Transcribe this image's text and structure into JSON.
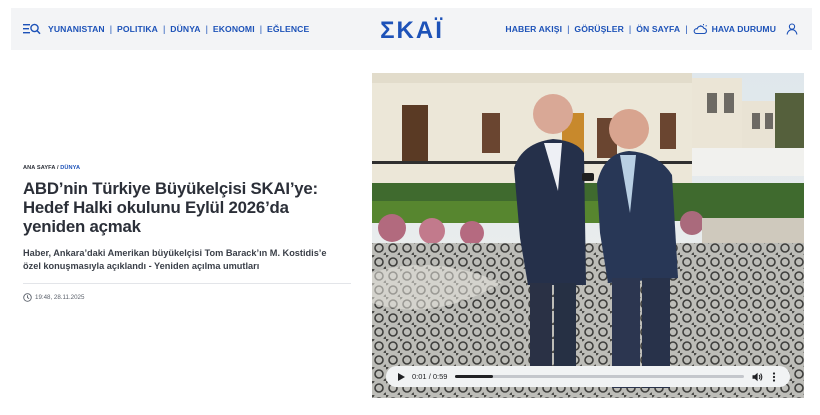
{
  "header": {
    "nav_left": [
      "YUNANISTAN",
      "POLITIKA",
      "DÜNYA",
      "EKONOMI",
      "EĞLENCE"
    ],
    "logo_text": "ΣΚΑΪ",
    "nav_right": [
      "HABER AKIŞI",
      "GÖRÜŞLER",
      "ÖN SAYFA"
    ],
    "weather_label": "HAVA DURUMU",
    "separator": "|"
  },
  "article": {
    "breadcrumb_home": "ANA SAYFA",
    "breadcrumb_sep": " / ",
    "breadcrumb_section": "DÜNYA",
    "title_lines": [
      "ABD’nin Türkiye Büyükelçisi SKAI’ye:",
      "Hedef Halki okulunu Eylül 2026’da",
      "yeniden açmak"
    ],
    "subtitle_lines": [
      "Haber, Ankara’daki Amerikan büyükelçisi Tom Barack’ın M. Kostidis’e",
      "özel konuşmasıyla açıklandı - Yeniden açılma umutları"
    ],
    "timestamp": "19:48, 28.11.2025"
  },
  "player": {
    "current_time": "0:01",
    "time_sep": " / ",
    "duration": "0:59",
    "progress": 0.13
  },
  "colors": {
    "brand_blue": "#1d52b8",
    "text_dark": "#2b2f38",
    "header_bg": "#f3f4f6"
  },
  "icons": {
    "menu": "menu-search-icon",
    "weather": "cloud-sun-icon",
    "user": "user-icon",
    "clock": "clock-icon",
    "play": "play-icon",
    "volume": "volume-icon",
    "more": "more-vertical-icon"
  }
}
